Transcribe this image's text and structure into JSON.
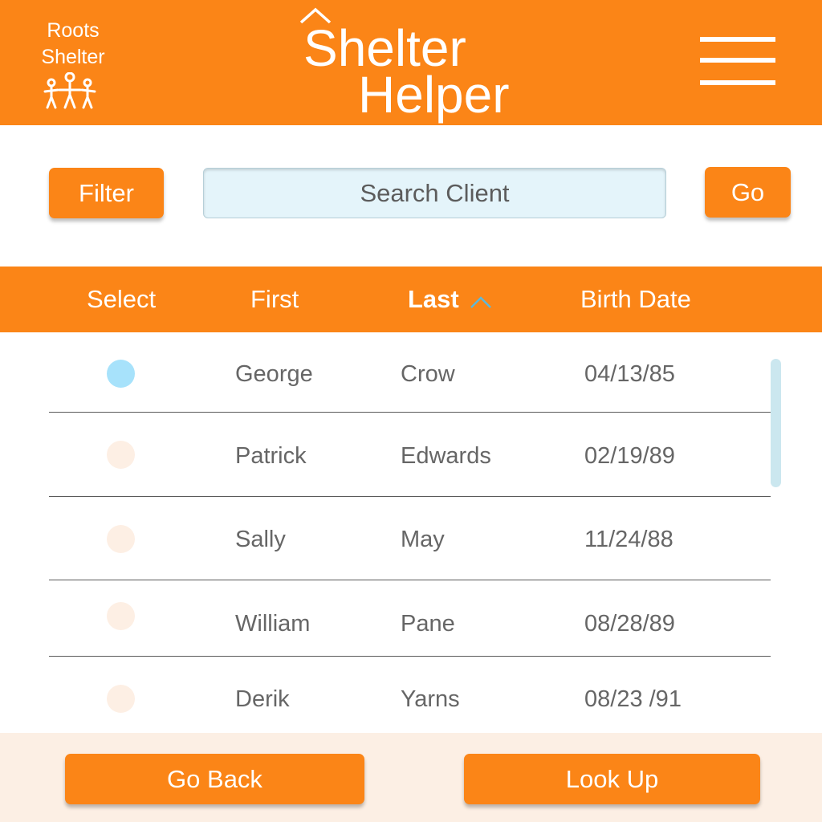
{
  "header": {
    "logo_line1": "Roots",
    "logo_line2": "Shelter",
    "title_line1": "Shelter",
    "title_line2": "Helper",
    "menu_icon": "hamburger-menu-icon"
  },
  "toolbar": {
    "filter_label": "Filter",
    "search_placeholder": "Search Client",
    "search_value": "",
    "go_label": "Go"
  },
  "table": {
    "columns": [
      "Select",
      "First",
      "Last",
      "Birth Date"
    ],
    "sorted_column": "Last",
    "sort_direction": "ascending",
    "rows": [
      {
        "selected": true,
        "first": "George",
        "last": "Crow",
        "birth_date": "04/13/85"
      },
      {
        "selected": false,
        "first": "Patrick",
        "last": "Edwards",
        "birth_date": "02/19/89"
      },
      {
        "selected": false,
        "first": "Sally",
        "last": "May",
        "birth_date": "11/24/88"
      },
      {
        "selected": false,
        "first": "William",
        "last": "Pane",
        "birth_date": "08/28/89"
      },
      {
        "selected": false,
        "first": "Derik",
        "last": "Yarns",
        "birth_date": "08/23 /91"
      }
    ]
  },
  "footer": {
    "back_label": "Go Back",
    "lookup_label": "Look Up"
  },
  "colors": {
    "accent": "#fb8517",
    "selected_radio": "#a7e2fb",
    "unselected_radio": "#fdefe4",
    "search_bg": "#e4f4fa",
    "footer_bg": "#fcefe4"
  }
}
